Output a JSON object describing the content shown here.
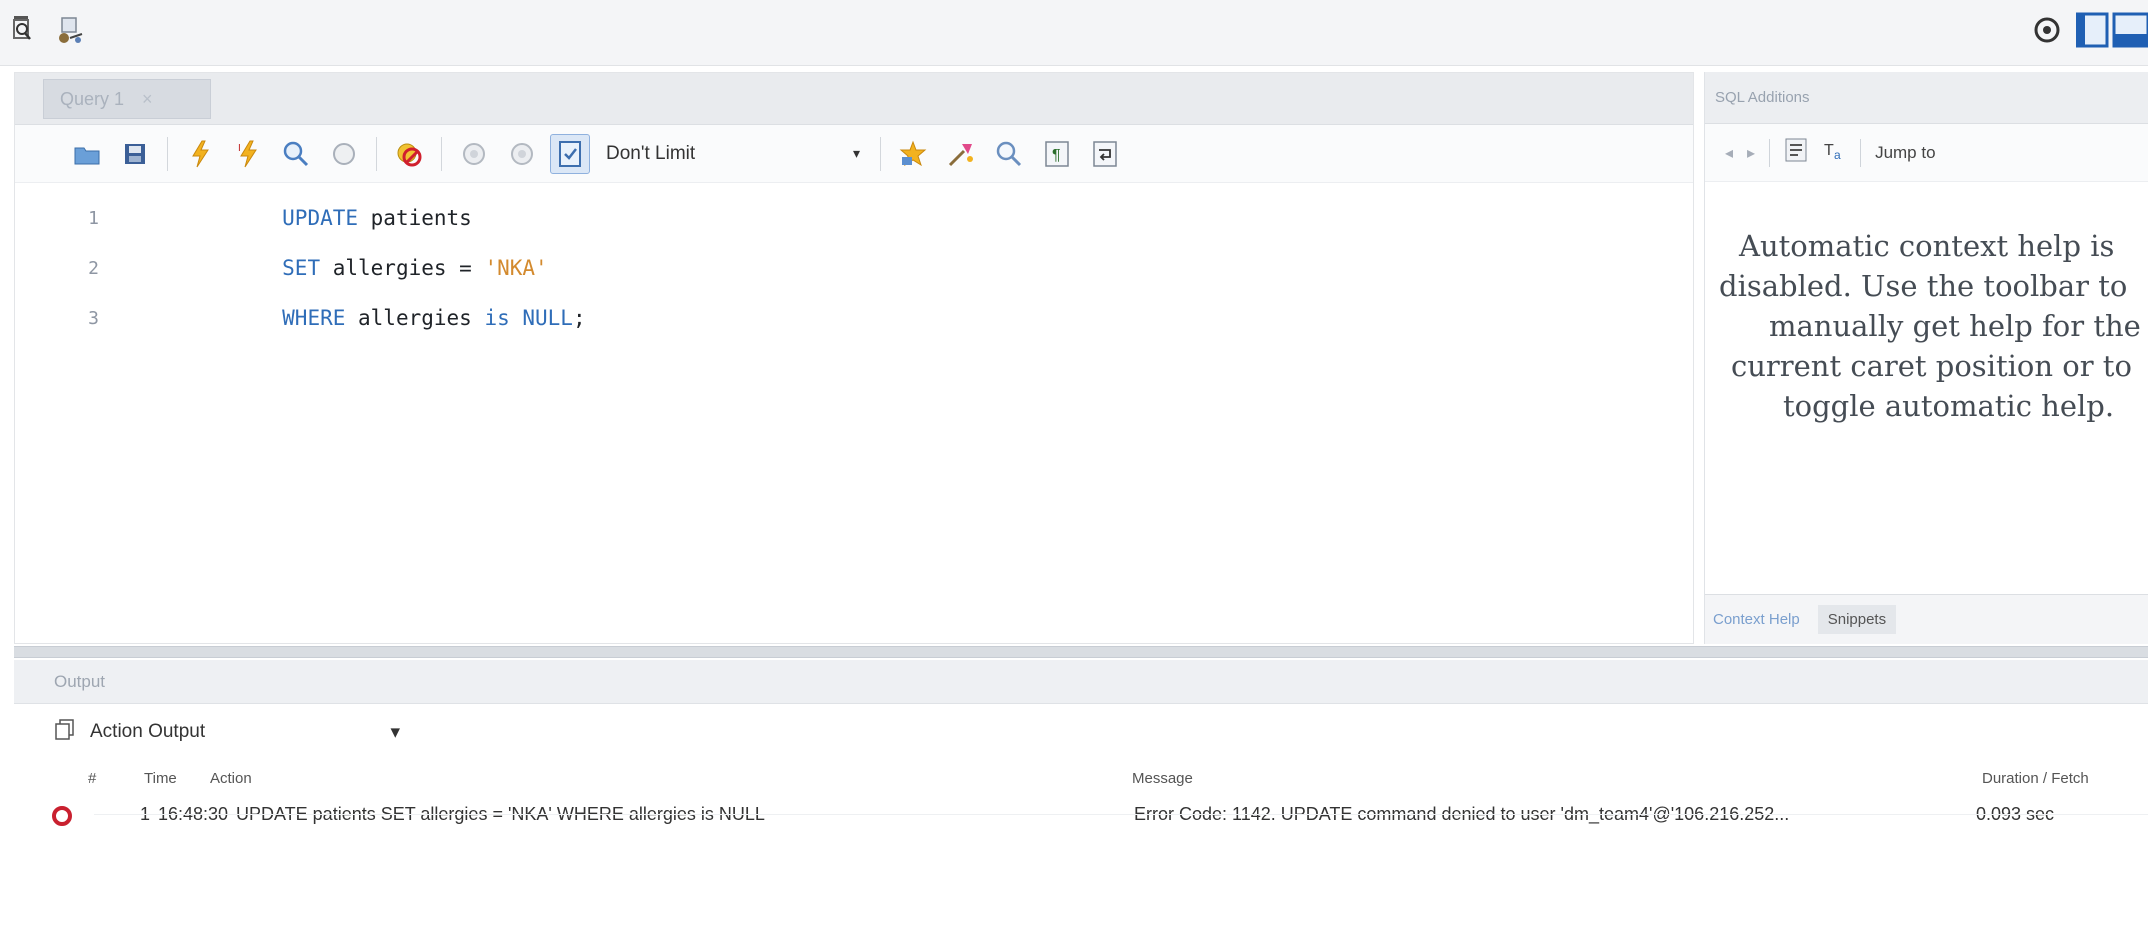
{
  "app": {
    "toolbar_icons": [
      "inspect-icon",
      "reconnect-icon"
    ],
    "right_icons": [
      "settings-gear-icon",
      "panel-layout-icon"
    ]
  },
  "editor": {
    "tab_label": "Query 1",
    "tab_close": "×",
    "toolbar": {
      "buttons": [
        "open-file-icon",
        "save-icon",
        "execute-icon",
        "execute-current-icon",
        "explain-icon",
        "stop-icon",
        "toggle-error-stop-icon",
        "commit-icon",
        "rollback-icon",
        "autocommit-icon"
      ],
      "limit_value": "Don't Limit",
      "limit_caret": "▾",
      "extra_buttons": [
        "add-snippet-icon",
        "beautify-icon",
        "find-icon",
        "invisible-chars-icon",
        "wrap-icon"
      ]
    },
    "lines": [
      {
        "no": "1",
        "tokens": [
          {
            "t": "UPDATE",
            "k": "kw"
          },
          {
            "t": " patients",
            "k": "plain"
          }
        ]
      },
      {
        "no": "2",
        "tokens": [
          {
            "t": "SET",
            "k": "kw"
          },
          {
            "t": " allergies = ",
            "k": "plain"
          },
          {
            "t": "'NKA'",
            "k": "str"
          }
        ]
      },
      {
        "no": "3",
        "tokens": [
          {
            "t": "WHERE",
            "k": "kw"
          },
          {
            "t": " allergies ",
            "k": "plain"
          },
          {
            "t": "is NULL",
            "k": "kw"
          },
          {
            "t": ";",
            "k": "plain"
          }
        ]
      }
    ]
  },
  "additions": {
    "title": "SQL Additions",
    "nav_back": "◂",
    "nav_forward": "▸",
    "jump_to": "Jump to",
    "help_lines": [
      "Automatic context help is",
      "disabled. Use the toolbar to",
      "manually get help for the",
      "current caret position or to",
      "toggle automatic help."
    ],
    "tabs": [
      "Context Help",
      "Snippets"
    ]
  },
  "output": {
    "title": "Output",
    "select_value": "Action Output",
    "select_caret": "▾",
    "columns": {
      "hash": "#",
      "time": "Time",
      "action": "Action",
      "message": "Message",
      "duration": "Duration / Fetch"
    },
    "rows": [
      {
        "status": "error",
        "num": "1",
        "time": "16:48:30",
        "action": "UPDATE patients SET allergies = 'NKA' WHERE allergies is NULL",
        "message": "Error Code: 1142. UPDATE command denied to user 'dm_team4'@'106.216.252...",
        "duration": "0.093 sec"
      }
    ]
  }
}
